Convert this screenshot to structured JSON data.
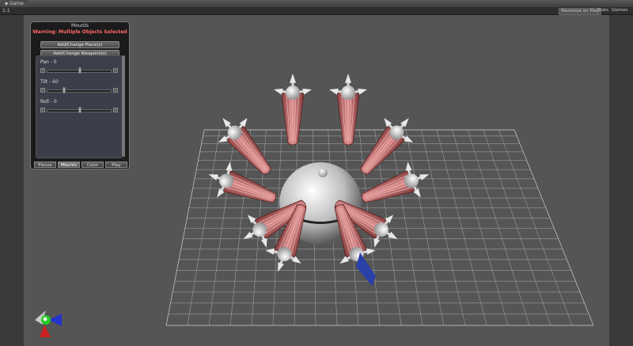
{
  "window": {
    "tab_title": "Game"
  },
  "toolbar": {
    "aspect": "1:1",
    "maximize_label": "Maximize on Play",
    "stats_label": "Stats",
    "gizmos_label": "Gizmos"
  },
  "panel": {
    "title": "Mounts",
    "warning": "Warning: Multiple Objects Selected",
    "add_pieces_label": "Add/Change Piece(s)",
    "add_weapons_label": "Add/Change Weapons(s)",
    "pan_label": "Pan - 0",
    "tilt_label": "Tilt - 60",
    "roll_label": "Roll - 0",
    "pan_value": 0,
    "tilt_value": 60,
    "roll_value": 0,
    "tabs": [
      "Pieces",
      "Mounts",
      "Color",
      "Play"
    ],
    "active_tab": "Mounts"
  },
  "icons": {
    "scene_gizmo": "axis-gizmo-icon"
  },
  "colors": {
    "warning": "#ff6a6a",
    "viewport": "#555555",
    "pieces": "#c86a6a"
  }
}
